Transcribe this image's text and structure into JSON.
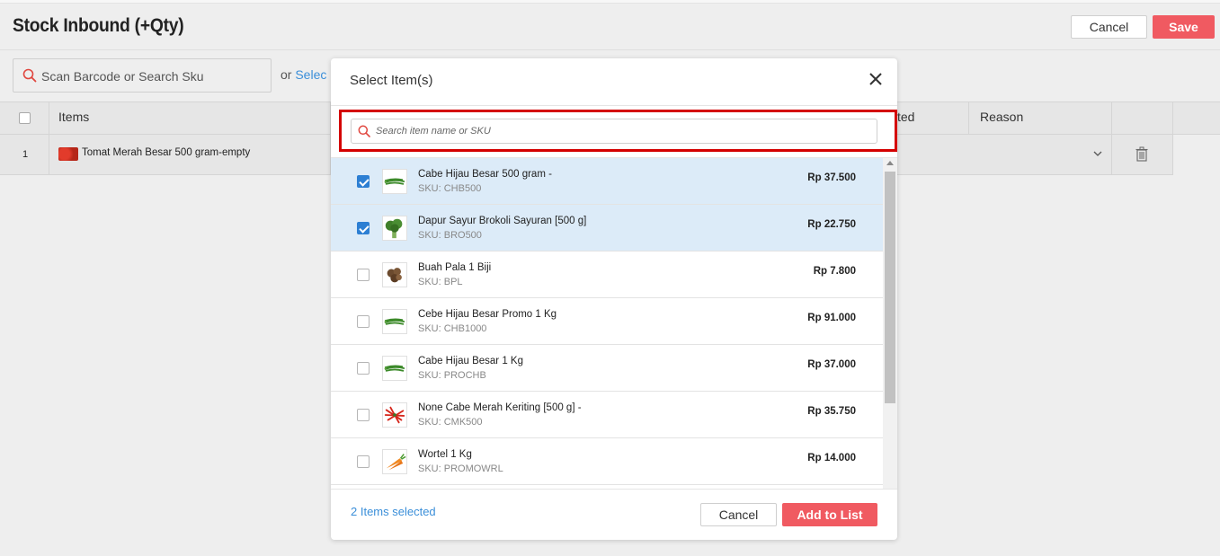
{
  "page": {
    "title": "Stock Inbound (+Qty)",
    "cancel_label": "Cancel",
    "save_label": "Save"
  },
  "toolbar": {
    "scan_placeholder": "Scan Barcode or Search Sku",
    "or_text": "or",
    "select_link": "Selec"
  },
  "table": {
    "headers": [
      "Items",
      "ted",
      "Reason"
    ],
    "rows": [
      {
        "index": "1",
        "item_name": "Tomat Merah Besar 500 gram-empty"
      }
    ]
  },
  "modal": {
    "title": "Select Item(s)",
    "search_placeholder": "Search item name or SKU",
    "items": [
      {
        "name": "Cabe Hijau Besar 500 gram -",
        "sku": "SKU: CHB500",
        "price": "Rp 37.500",
        "checked": true,
        "image": "green-chili"
      },
      {
        "name": "Dapur Sayur Brokoli Sayuran [500 g]",
        "sku": "SKU: BRO500",
        "price": "Rp 22.750",
        "checked": true,
        "image": "broccoli"
      },
      {
        "name": "Buah Pala 1 Biji",
        "sku": "SKU: BPL",
        "price": "Rp 7.800",
        "checked": false,
        "image": "nutmeg"
      },
      {
        "name": "Cebe Hijau Besar Promo 1 Kg",
        "sku": "SKU: CHB1000",
        "price": "Rp 91.000",
        "checked": false,
        "image": "green-chili"
      },
      {
        "name": "Cabe Hijau Besar 1 Kg",
        "sku": "SKU: PROCHB",
        "price": "Rp 37.000",
        "checked": false,
        "image": "green-chili"
      },
      {
        "name": "None Cabe Merah Keriting [500 g] -",
        "sku": "SKU: CMK500",
        "price": "Rp 35.750",
        "checked": false,
        "image": "red-chili"
      },
      {
        "name": "Wortel 1 Kg",
        "sku": "SKU: PROMOWRL",
        "price": "Rp 14.000",
        "checked": false,
        "image": "carrot"
      }
    ],
    "selected_count": "2 Items selected",
    "cancel_label": "Cancel",
    "add_label": "Add to List"
  },
  "colors": {
    "accent": "#f05a61",
    "link": "#3b8fd9",
    "selected_row": "#dcebf8",
    "highlight": "#d40000"
  }
}
